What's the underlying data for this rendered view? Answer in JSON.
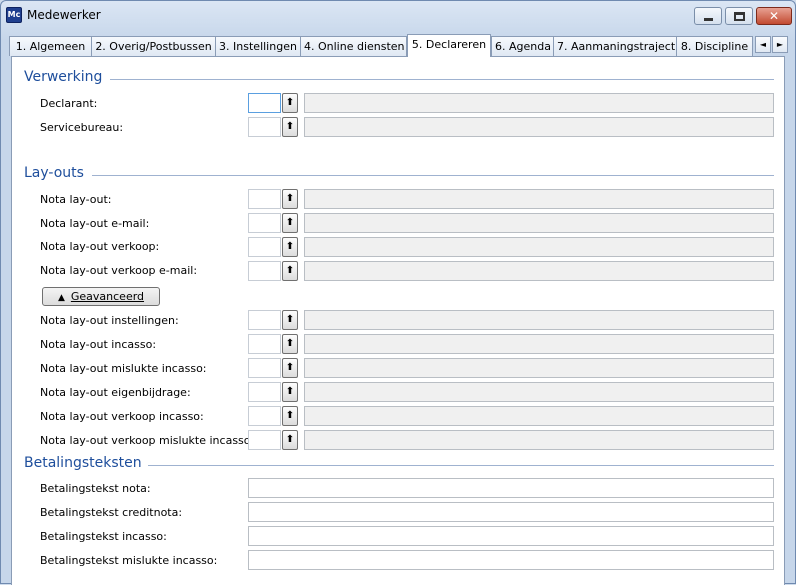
{
  "window": {
    "title": "Medewerker",
    "app_icon": "app-logo-icon",
    "controls": {
      "minimize": "minimize-icon",
      "maximize": "maximize-icon",
      "close": "close-icon"
    }
  },
  "tabs": [
    {
      "label": "1. Algemeen",
      "active": false
    },
    {
      "label": "2. Overig/Postbussen",
      "active": false
    },
    {
      "label": "3. Instellingen",
      "active": false
    },
    {
      "label": "4. Online diensten",
      "active": false
    },
    {
      "label": "5. Declareren",
      "active": true
    },
    {
      "label": "6. Agenda",
      "active": false
    },
    {
      "label": "7. Aanmaningstraject",
      "active": false
    },
    {
      "label": "8. Discipline",
      "active": false
    }
  ],
  "tab_scroll": {
    "left": "◄",
    "right": "►"
  },
  "verwerking": {
    "title": "Verwerking",
    "rows": [
      {
        "label": "Declarant:",
        "code": "",
        "description": ""
      },
      {
        "label": "Servicebureau:",
        "code": "",
        "description": ""
      }
    ]
  },
  "layouts": {
    "title": "Lay-outs",
    "rows": [
      {
        "label": "Nota lay-out:",
        "code": "",
        "description": ""
      },
      {
        "label": "Nota lay-out e-mail:",
        "code": "",
        "description": ""
      },
      {
        "label": "Nota lay-out verkoop:",
        "code": "",
        "description": ""
      },
      {
        "label": "Nota lay-out verkoop e-mail:",
        "code": "",
        "description": ""
      }
    ],
    "advanced_button": "Geavanceerd",
    "advanced_rows": [
      {
        "label": "Nota lay-out instellingen:",
        "code": "",
        "description": ""
      },
      {
        "label": "Nota lay-out incasso:",
        "code": "",
        "description": ""
      },
      {
        "label": "Nota lay-out mislukte incasso:",
        "code": "",
        "description": ""
      },
      {
        "label": "Nota lay-out eigenbijdrage:",
        "code": "",
        "description": ""
      },
      {
        "label": "Nota lay-out verkoop incasso:",
        "code": "",
        "description": ""
      },
      {
        "label": "Nota lay-out verkoop mislukte incasso:",
        "code": "",
        "description": ""
      }
    ]
  },
  "betalingsteksten": {
    "title": "Betalingsteksten",
    "rows": [
      {
        "label": "Betalingstekst nota:",
        "value": ""
      },
      {
        "label": "Betalingstekst creditnota:",
        "value": ""
      },
      {
        "label": "Betalingstekst incasso:",
        "value": ""
      },
      {
        "label": "Betalingstekst mislukte incasso:",
        "value": ""
      }
    ]
  },
  "lookup_icon": "lookup-arrow-icon",
  "colors": {
    "section_title": "#1e4e9c",
    "window_frame": "#c6d6ea",
    "close_button": "#c24a31"
  }
}
